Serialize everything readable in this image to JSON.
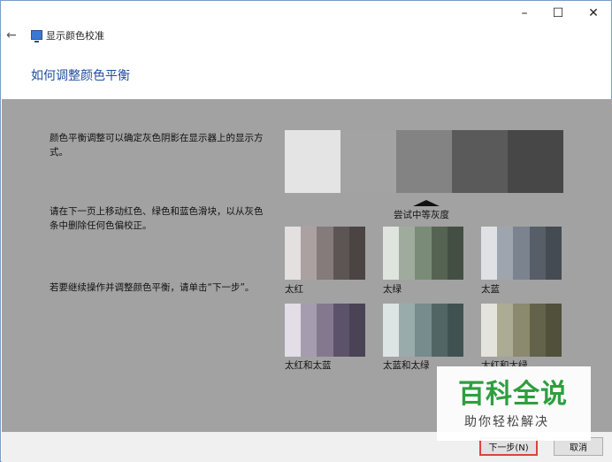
{
  "window": {
    "controls": {
      "minimize": "–",
      "maximize": "☐",
      "close": "✕"
    },
    "app_title": "显示颜色校准",
    "back_icon": "←"
  },
  "page_title": "如何调整颜色平衡",
  "instructions": [
    "颜色平衡调整可以确定灰色阴影在显示器上的显示方式。",
    "请在下一页上移动红色、绿色和蓝色滑块，以从灰色条中删除任何色偏校正。",
    "若要继续操作并调整颜色平衡，请单击“下一步”。"
  ],
  "reference": {
    "label": "尝试中等灰度",
    "colors": [
      "#e4e4e4",
      "#a3a3a3",
      "#838383",
      "#5a5a5a",
      "#474747"
    ]
  },
  "samples": [
    {
      "label": "太红",
      "colors": [
        "#e4e0e0",
        "#aba1a0",
        "#857b7a",
        "#5d5554",
        "#4b4443"
      ]
    },
    {
      "label": "太绿",
      "colors": [
        "#dfe4df",
        "#9fac9d",
        "#7a8c78",
        "#556452",
        "#434f42"
      ]
    },
    {
      "label": "太蓝",
      "colors": [
        "#dfe1e5",
        "#9ea5ae",
        "#7b848e",
        "#575e67",
        "#454b53"
      ]
    },
    {
      "label": "太红和太蓝",
      "colors": [
        "#e2dde6",
        "#a59caf",
        "#84788f",
        "#5c536a",
        "#4a4255"
      ]
    },
    {
      "label": "太蓝和太绿",
      "colors": [
        "#dde4e4",
        "#9aabab",
        "#778c8c",
        "#526565",
        "#405151"
      ]
    },
    {
      "label": "太红和太绿",
      "colors": [
        "#e4e4dd",
        "#acab93",
        "#8b8a6e",
        "#63624b",
        "#50503b"
      ]
    }
  ],
  "buttons": {
    "next": "下一步(N)",
    "cancel": "取消"
  },
  "watermark": {
    "main": "百科全说",
    "sub": "助你轻松解决"
  }
}
